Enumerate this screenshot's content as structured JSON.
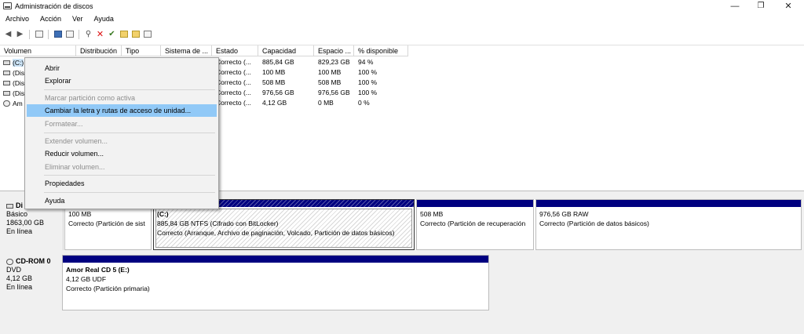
{
  "window": {
    "title": "Administración de discos",
    "buttons": {
      "minimize": "—",
      "maximize": "❐",
      "close": "✕"
    }
  },
  "menu": [
    "Archivo",
    "Acción",
    "Ver",
    "Ayuda"
  ],
  "toolbar_icons": [
    "back-arrow-icon",
    "forward-arrow-icon",
    "console-tree-icon",
    "help-icon",
    "properties-icon",
    "connect-icon",
    "delete-icon",
    "check-icon",
    "folder-up-icon",
    "folder-icon",
    "view-icon"
  ],
  "columns": [
    "Volumen",
    "Distribución",
    "Tipo",
    "Sistema de ...",
    "Estado",
    "Capacidad",
    "Espacio ...",
    "% disponible"
  ],
  "volumes": [
    {
      "vol": "(C:)",
      "estado": "Correcto (...",
      "capacidad": "885,84 GB",
      "espacio": "829,23 GB",
      "pct": "94 %"
    },
    {
      "vol": "(Dis",
      "estado": "Correcto (...",
      "capacidad": "100 MB",
      "espacio": "100 MB",
      "pct": "100 %"
    },
    {
      "vol": "(Dis",
      "estado": "Correcto (...",
      "capacidad": "508 MB",
      "espacio": "508 MB",
      "pct": "100 %"
    },
    {
      "vol": "(Dis",
      "estado": "Correcto (...",
      "capacidad": "976,56 GB",
      "espacio": "976,56 GB",
      "pct": "100 %"
    },
    {
      "vol": "Am",
      "estado": "Correcto (...",
      "capacidad": "4,12 GB",
      "espacio": "0 MB",
      "pct": "0 %"
    }
  ],
  "context_menu": [
    {
      "label": "Abrir",
      "enabled": true
    },
    {
      "label": "Explorar",
      "enabled": true
    },
    {
      "label": "Marcar partición como activa",
      "enabled": false
    },
    {
      "label": "Cambiar la letra y rutas de acceso de unidad...",
      "enabled": true,
      "highlighted": true
    },
    {
      "label": "Formatear...",
      "enabled": false
    },
    {
      "label": "Extender volumen...",
      "enabled": false
    },
    {
      "label": "Reducir volumen...",
      "enabled": true
    },
    {
      "label": "Eliminar volumen...",
      "enabled": false
    },
    {
      "label": "Propiedades",
      "enabled": true
    },
    {
      "label": "Ayuda",
      "enabled": true
    }
  ],
  "disk0": {
    "name": "Di",
    "type": "Básico",
    "size": "1863,00 GB",
    "status": "En línea",
    "partitions": [
      {
        "line1": "100 MB",
        "line2": "Correcto (Partición de sist"
      },
      {
        "name": "(C:)",
        "line1": "885,84 GB NTFS (Cifrado con BitLocker)",
        "line2": "Correcto (Arranque, Archivo de paginación, Volcado, Partición de datos básicos)"
      },
      {
        "line1": "508 MB",
        "line2": "Correcto (Partición de recuperación"
      },
      {
        "line1": "976,56 GB RAW",
        "line2": "Correcto (Partición de datos básicos)"
      }
    ]
  },
  "cdrom": {
    "name": "CD-ROM 0",
    "type": "DVD",
    "size": "4,12 GB",
    "status": "En línea",
    "partition": {
      "name": "Amor Real CD 5  (E:)",
      "line1": "4,12 GB UDF",
      "line2": "Correcto (Partición primaria)"
    }
  },
  "colors": {
    "partition_bar": "#000080",
    "menu_highlight": "#91c9f7"
  }
}
